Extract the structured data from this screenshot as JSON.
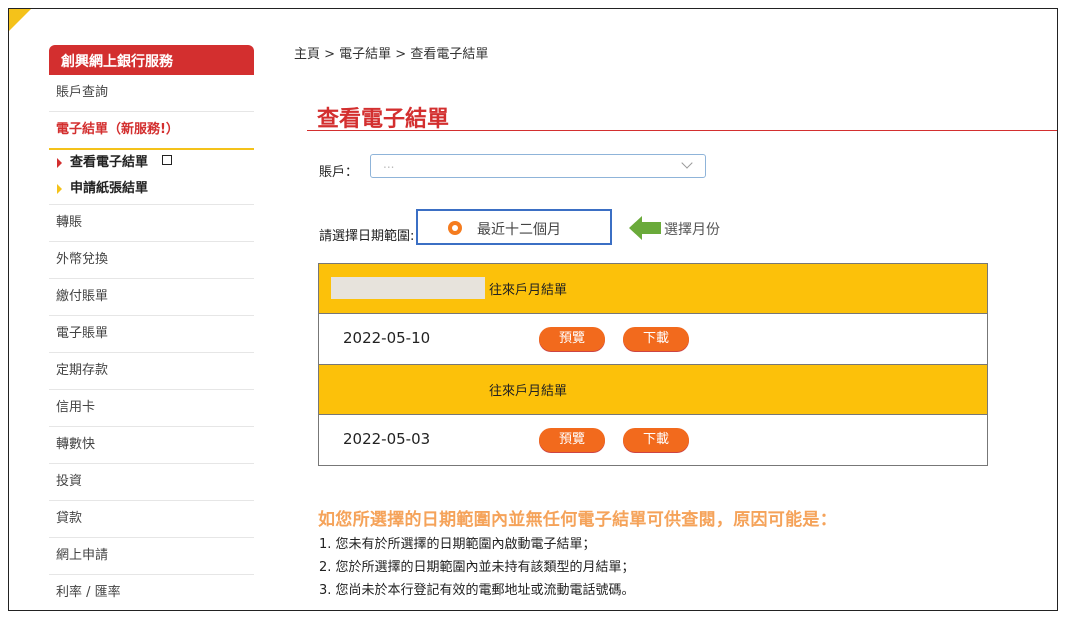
{
  "breadcrumb": "主頁 > 電子結單 > 查看電子結單",
  "page_title": "查看電子結單",
  "sidebar": {
    "title": "創興網上銀行服務",
    "items": [
      {
        "label": "賬戶查詢"
      },
      {
        "label": "電子結單（新服務!）"
      },
      {
        "label": "轉賬"
      },
      {
        "label": "外幣兌換"
      },
      {
        "label": "繳付賬單"
      },
      {
        "label": "電子賬單"
      },
      {
        "label": "定期存款"
      },
      {
        "label": "信用卡"
      },
      {
        "label": "轉數快"
      },
      {
        "label": "投資"
      },
      {
        "label": "貸款"
      },
      {
        "label": "網上申請"
      },
      {
        "label": "利率 / 匯率"
      }
    ],
    "sub_items": [
      {
        "label": "查看電子結單"
      },
      {
        "label": "申請紙張結單"
      }
    ]
  },
  "account": {
    "label": "賬戶：",
    "placeholder": "..."
  },
  "date_range": {
    "label": "請選擇日期範圍:",
    "option_recent": "最近十二個月",
    "option_month": "選擇月份"
  },
  "statements": [
    {
      "type": "往來戶月結單",
      "date": "2022-05-10",
      "preview": "預覽",
      "download": "下載"
    },
    {
      "type": "往來戶月結單",
      "date": "2022-05-03",
      "preview": "預覽",
      "download": "下載"
    }
  ],
  "notes": {
    "title": "如您所選擇的日期範圍內並無任何電子結單可供查閱，原因可能是：",
    "lines": [
      "1. 您未有於所選擇的日期範圍內啟動電子結單；",
      "2. 您於所選擇的日期範圍內並未持有該類型的月結單；",
      "3. 您尚未於本行登記有效的電郵地址或流動電話號碼。"
    ]
  },
  "colors": {
    "accent_red": "#d32f2f",
    "header_yellow": "#fcc10a",
    "button_orange": "#f26a1d",
    "highlight_blue": "#3b6fc4",
    "arrow_green": "#6aaa3a"
  }
}
